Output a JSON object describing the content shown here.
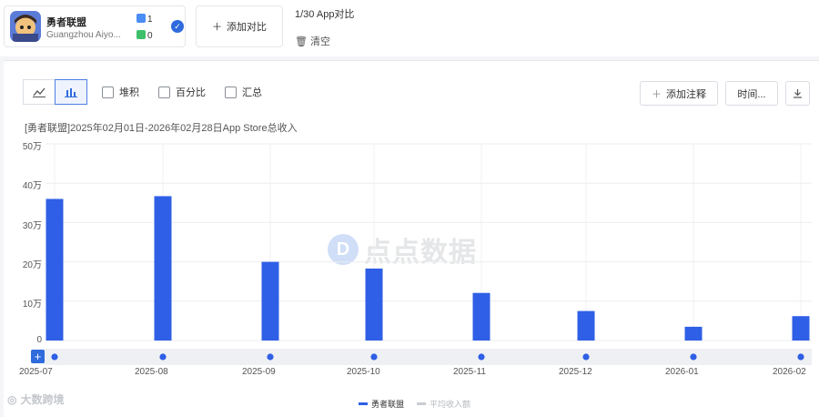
{
  "compare": {
    "app_name": "勇者联盟",
    "developer": "Guangzhou Aiyo...",
    "ios_count": "1",
    "android_count": "0",
    "add_label": "添加对比",
    "counter": "1/30 App对比",
    "clear_label": "清空"
  },
  "toolbar": {
    "stack_label": "堆积",
    "percent_label": "百分比",
    "sum_label": "汇总",
    "add_note_label": "添加注释",
    "time_label": "时间..."
  },
  "watermark": "点点数据",
  "corner_mark": "大数跨境",
  "colors": {
    "primary": "#2f5fe6",
    "secondary": "#c9ccd1"
  },
  "chart_data": {
    "type": "bar",
    "title": "[勇者联盟]2025年02月01日-2026年02月28日App Store总收入",
    "y_ticks": [
      "50万",
      "40万",
      "30万",
      "20万",
      "10万",
      "0"
    ],
    "ylim": [
      0,
      500000
    ],
    "categories": [
      "2025-07",
      "2025-08",
      "2025-09",
      "2025-10",
      "2025-11",
      "2025-12",
      "2026-01",
      "2026-02"
    ],
    "series": [
      {
        "name": "勇者联盟",
        "color": "#2f5fe6",
        "values": [
          360000,
          367000,
          200000,
          183000,
          121000,
          75000,
          35000,
          62000
        ]
      }
    ],
    "legend": [
      {
        "name": "勇者联盟",
        "color": "#2f5fe6"
      },
      {
        "name": "平均收入额",
        "color": "#c9ccd1"
      }
    ],
    "grid": true,
    "legend_position": "bottom"
  }
}
